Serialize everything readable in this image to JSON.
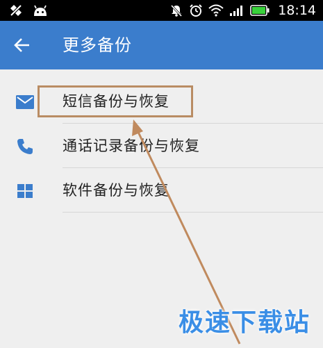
{
  "status_bar": {
    "time": "18:14",
    "icons_left": [
      "screenshot-icon",
      "android-icon"
    ],
    "icons_right": [
      "mute-icon",
      "alarm-icon",
      "wifi-icon",
      "signal-icon",
      "battery-icon"
    ]
  },
  "app_bar": {
    "back_icon": "arrow-left-icon",
    "title": "更多备份",
    "color": "#3b7dcc"
  },
  "list": {
    "items": [
      {
        "icon": "mail-icon",
        "label": "短信备份与恢复"
      },
      {
        "icon": "phone-icon",
        "label": "通话记录备份与恢复"
      },
      {
        "icon": "apps-grid-icon",
        "label": "软件备份与恢复"
      }
    ],
    "icon_color": "#3b7dcc"
  },
  "annotation": {
    "highlight_color": "#b98c63"
  },
  "watermark": {
    "text": "极速下载站",
    "color": "#3a8ee6"
  }
}
